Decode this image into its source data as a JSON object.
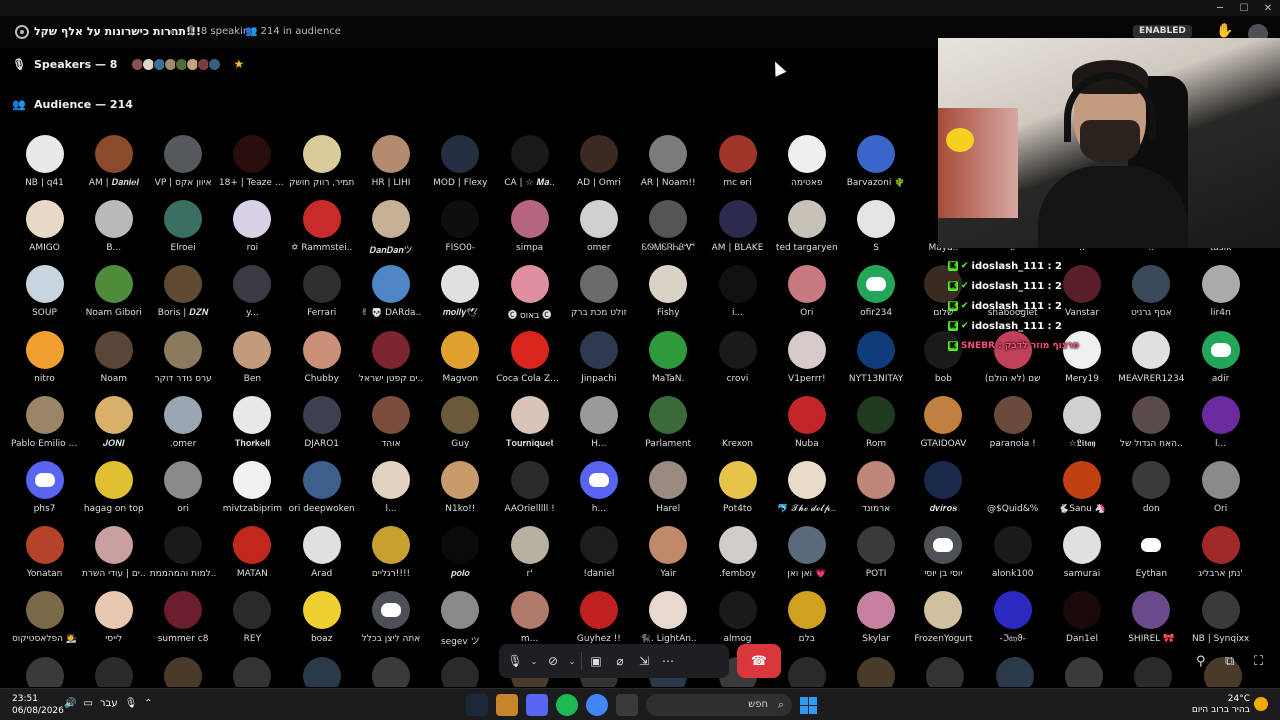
{
  "window": {
    "controls": [
      "─",
      "☐",
      "✕"
    ]
  },
  "topbar": {
    "title": "תחרות כישרונות על אלף שקל!!!",
    "speaking": "8 speaking",
    "audience_count": "214 in audience",
    "enabled_label": "ENABLED",
    "hand_icon": "✋"
  },
  "speakers": {
    "label": "Speakers — 8",
    "avatar_colors": [
      "#8a4f4f",
      "#ded8cc",
      "#3d6e9a",
      "#a58a6a",
      "#546a3c",
      "#c8a27c",
      "#7b3e3e",
      "#3b5f7a"
    ]
  },
  "audience": {
    "label": "Audience — 214",
    "rows": [
      [
        {
          "n": "NB | q41",
          "c": "#e9e9e9"
        },
        {
          "n": "AM | 𝑫𝒂𝒏𝒊𝒆𝒍",
          "c": "#8a4b2c"
        },
        {
          "n": "VP | איוון אקס",
          "c": "#55585c"
        },
        {
          "n": "18+ | Teaze (יי..",
          "c": "#2a0d0d"
        },
        {
          "n": "תמיר, רווק חושק",
          "c": "#d9cc9a"
        },
        {
          "n": "HR | LIHI",
          "c": "#b58b6f"
        },
        {
          "n": "MOD | Flexy",
          "c": "#243041"
        },
        {
          "n": "CA | ☆ 𝑴𝒂..",
          "c": "#191919"
        },
        {
          "n": "AD | Omri",
          "c": "#3a2a22"
        },
        {
          "n": "AR | Noam!!",
          "c": "#7c7c7c"
        },
        {
          "n": "mc ɵri",
          "c": "#a0352a"
        },
        {
          "n": "פאטימה",
          "c": "#efefef"
        },
        {
          "n": "Barvazoni 🌵",
          "c": "#3b66c9"
        },
        {
          "n": "",
          "c": "#3e6fb0"
        }
      ],
      [
        {
          "n": "AMIGO",
          "c": "#e7d9c6"
        },
        {
          "n": "B...",
          "c": "#b9b9b9"
        },
        {
          "n": "Elroei",
          "c": "#3b6f62"
        },
        {
          "n": "roi",
          "c": "#d9d2e6"
        },
        {
          "n": "✡ Rammstei..",
          "c": "#c92a2a"
        },
        {
          "n": "𝑫𝒂𝒏𝑫𝒂𝒏ツ",
          "c": "#c7b195"
        },
        {
          "n": "FISO0-",
          "c": "#0e0e0e"
        },
        {
          "n": "simpa",
          "c": "#b5657e"
        },
        {
          "n": "omer",
          "c": "#d0d0d0"
        },
        {
          "n": "ᏋᏫᎷᏋᏒᏂᏰᏉ",
          "c": "#555"
        },
        {
          "n": "AM | BLAKE",
          "c": "#2d2a4f"
        },
        {
          "n": "ted targaryen",
          "c": "#c8c1b8"
        },
        {
          "n": "S",
          "c": "#e5e5e5"
        },
        {
          "n": "",
          "c": "#000"
        }
      ],
      [
        {
          "n": "SOUP",
          "c": "#c8d4e0"
        },
        {
          "n": "Noam Gibori",
          "c": "#4e8c3a"
        },
        {
          "n": "Boris | 𝑫𝒁𝑵",
          "c": "#5f4a34"
        },
        {
          "n": "y...",
          "c": "#3a3a44"
        },
        {
          "n": "Ferrari",
          "c": "#2f2f2f"
        },
        {
          "n": "✌ 💀 DARda..",
          "c": "#4f86c6"
        },
        {
          "n": "𝒎𝒐𝒍𝒍𝒚🕊",
          "c": "#e0e0e0"
        },
        {
          "n": "🅒 באוס 🅒",
          "c": "#e08fa0"
        },
        {
          "n": "זולט מכת ברק",
          "c": "#6b6b6b"
        },
        {
          "n": "Fishy",
          "c": "#d9d2c6"
        },
        {
          "n": "i...",
          "c": "#111"
        },
        {
          "n": "Ori",
          "c": "#c77a80"
        },
        {
          "n": "ofir234",
          "c": "#23a55a",
          "d": true
        },
        {
          "n": "",
          "c": "#000"
        }
      ],
      [
        {
          "n": "nitro",
          "c": "#f0a030"
        },
        {
          "n": "Noam",
          "c": "#5a4638"
        },
        {
          "n": "ערס נודר דוקר",
          "c": "#8c7a5e"
        },
        {
          "n": "Ben",
          "c": "#c39a7a"
        },
        {
          "n": "Chubby",
          "c": "#c98f79"
        },
        {
          "n": "ים קפטן ישראל..",
          "c": "#7b2530"
        },
        {
          "n": "Magvon",
          "c": "#e0a030"
        },
        {
          "n": "Coca Cola Zero",
          "c": "#d9251c"
        },
        {
          "n": "Jinpachi",
          "c": "#2e3a52"
        },
        {
          "n": "MaTaN.",
          "c": "#2f9a3c"
        },
        {
          "n": "crovi",
          "c": "#1a1a1a"
        },
        {
          "n": "V1perrr!",
          "c": "#d6cbc9"
        },
        {
          "n": "NYT13NITAY",
          "c": "#0f3c7a"
        },
        {
          "n": "",
          "c": "#000"
        }
      ],
      [
        {
          "n": "Pablo Emilio E..",
          "c": "#9a8566"
        },
        {
          "n": "𝑱𝑶𝑵𝑰",
          "c": "#d8b06a"
        },
        {
          "n": ".omer",
          "c": "#9aa6b0"
        },
        {
          "n": "𝐓𝐡𝐨𝐫𝐤𝐞𝐥𝐥",
          "c": "#e8e8e8"
        },
        {
          "n": "DJARO1",
          "c": "#3c4050"
        },
        {
          "n": "אוהד",
          "c": "#7a4c3c"
        },
        {
          "n": "Guy",
          "c": "#6b5a3a"
        },
        {
          "n": "𝐓𝐨𝐮𝐫𝐧𝐢𝐪𝐮𝐞𝐭",
          "c": "#d8c4b8"
        },
        {
          "n": "H...",
          "c": "#9a9a9a"
        },
        {
          "n": "Parlament",
          "c": "#3a6a3a"
        },
        {
          "n": "Krexon",
          "c": "#000"
        },
        {
          "n": "Nuba",
          "c": "#c2262a"
        },
        {
          "n": "Rom",
          "c": "#1f3a1f"
        },
        {
          "n": "",
          "c": "#000"
        }
      ],
      [
        {
          "n": "phs7",
          "c": "#5865f2",
          "d": true
        },
        {
          "n": "hagag on top",
          "c": "#e0c030"
        },
        {
          "n": "ori",
          "c": "#8a8a8a"
        },
        {
          "n": "mivtzabiprim",
          "c": "#f0f0f0"
        },
        {
          "n": "ori deepwoken",
          "c": "#3e5f8a"
        },
        {
          "n": "l...",
          "c": "#e2d2c0"
        },
        {
          "n": "N1ko!!",
          "c": "#c99a6a"
        },
        {
          "n": "AAOrielllll !",
          "c": "#2a2a2a"
        },
        {
          "n": "h...",
          "c": "#5865f2",
          "d": true
        },
        {
          "n": "Harel",
          "c": "#9a8a80"
        },
        {
          "n": "Pot4to",
          "c": "#e6c34a"
        },
        {
          "n": "🐬 𝓣𝓱𝓮 𝓭𝓸𝓵𝓹..",
          "c": "#e8dcc8"
        },
        {
          "n": "ארמונד",
          "c": "#c0857a"
        },
        {
          "n": "",
          "c": "#000"
        }
      ],
      [
        {
          "n": "Yonatan",
          "c": "#b5432a"
        },
        {
          "n": "ים | עודי השרת..",
          "c": "#c8a0a0"
        },
        {
          "n": "למות והמהממת..",
          "c": "#1a1a1a"
        },
        {
          "n": "MATAN",
          "c": "#c0291c"
        },
        {
          "n": "Arad",
          "c": "#e0e0e0"
        },
        {
          "n": "רגליים!!!!",
          "c": "#c8a030"
        },
        {
          "n": "𝒑𝒐𝒍𝒐",
          "c": "#0a0a0a"
        },
        {
          "n": "r'",
          "c": "#b8b0a0"
        },
        {
          "n": "!daniel",
          "c": "#1e1e1e"
        },
        {
          "n": "Yair",
          "c": "#c08a6a"
        },
        {
          "n": ".femboy",
          "c": "#d0cdc8"
        },
        {
          "n": "ואן ואן 💗",
          "c": "#5a6a7a"
        },
        {
          "n": "POTI",
          "c": "#3a3a3a"
        },
        {
          "n": "",
          "c": "#000"
        }
      ],
      [
        {
          "n": "הפלאסטיקוס 🧑‍🎨",
          "c": "#7a6a4a"
        },
        {
          "n": "לייסי",
          "c": "#e8c8b0"
        },
        {
          "n": "summer c8",
          "c": "#6a1e2e"
        },
        {
          "n": "REY",
          "c": "#2a2a2a"
        },
        {
          "n": "boaz",
          "c": "#f0d030"
        },
        {
          "n": "אתה ליצן בכלל",
          "c": "#4e5058",
          "d": true
        },
        {
          "n": "segev ツ",
          "c": "#8a8a8a"
        },
        {
          "n": "m...",
          "c": "#b07a6a"
        },
        {
          "n": "Guyhez !!",
          "c": "#c02020"
        },
        {
          "n": "🐈‍⬛. LightAn..",
          "c": "#e8d8d0"
        },
        {
          "n": "almog",
          "c": "#1a1a1a"
        },
        {
          "n": "בלם",
          "c": "#d0a020"
        },
        {
          "n": "Skylar",
          "c": "#c880a0"
        },
        {
          "n": "",
          "c": "#000"
        }
      ]
    ]
  },
  "audience_right": {
    "rows": [
      [
        {
          "n": "Maya..",
          "c": "#000"
        },
        {
          "n": "..",
          "c": "#000"
        },
        {
          "n": "..",
          "c": "#000"
        },
        {
          "n": "..",
          "c": "#000"
        },
        {
          "n": "tasik",
          "c": "#000"
        }
      ],
      [
        {
          "n": "שלום",
          "c": "#3a2a22"
        },
        {
          "n": "shabooglet",
          "c": "#000"
        },
        {
          "n": "Vanstar",
          "c": "#5a1e2a"
        },
        {
          "n": "אסף גרניט",
          "c": "#3a4a5a"
        },
        {
          "n": "lir4n",
          "c": "#aaa"
        }
      ],
      [
        {
          "n": "bob",
          "c": "#1a1a1a"
        },
        {
          "n": "שם (לא הולם)",
          "c": "#c0405a"
        },
        {
          "n": "Mery19",
          "c": "#f0f0f0"
        },
        {
          "n": "MEAVRER1234",
          "c": "#e0e0e0"
        },
        {
          "n": "adir",
          "c": "#23a55a",
          "d": true
        }
      ],
      [
        {
          "n": "GTAIDOAV",
          "c": "#c08040"
        },
        {
          "n": "paranoia !",
          "c": "#6a4a3a"
        },
        {
          "n": "☆𝕷𝖎𝖙𝖆𝖞",
          "c": "#d0d0d0"
        },
        {
          "n": "האח הגדול של..",
          "c": "#5a4a4a"
        },
        {
          "n": "l...",
          "c": "#6a2aa0"
        }
      ],
      [
        {
          "n": "𝒅𝒗𝒊𝒓𝒐𝒔",
          "c": "#1a2a4a"
        },
        {
          "n": "@$Quid&%",
          "c": "#000"
        },
        {
          "n": "🐇Sanu 🦄",
          "c": "#c04010"
        },
        {
          "n": "don",
          "c": "#3a3a3a"
        },
        {
          "n": "Ori",
          "c": "#8a8a8a"
        }
      ],
      [
        {
          "n": "יוסי בן יוסי",
          "c": "#4e5058",
          "d": true
        },
        {
          "n": "alonk100",
          "c": "#1a1a1a"
        },
        {
          "n": "samurai",
          "c": "#e0e0e0"
        },
        {
          "n": "Eythan",
          "c": "#000",
          "d": true
        },
        {
          "n": "נתן ארבליג'",
          "c": "#a02a2a"
        }
      ],
      [
        {
          "n": "FrozenYogurt",
          "c": "#d0c0a0"
        },
        {
          "n": "-ℑ𝔞𝔶ϑ-",
          "c": "#2a2ac0"
        },
        {
          "n": "Dan1el",
          "c": "#1a0a0a"
        },
        {
          "n": "SHIREL 🎀",
          "c": "#6a4a8a"
        },
        {
          "n": "NB | Synqixx",
          "c": "#3a3a3a"
        }
      ]
    ]
  },
  "overlay_chat": {
    "lines": [
      "idoslash_111 : 2",
      "idoslash_111 : 2",
      "idoslash_111 : 2",
      "idoslash_111 : 2"
    ],
    "last_line": "SNEBR : פרצוף מוזר לדבק"
  },
  "callbar": {
    "leave_icon": "☎"
  },
  "taskbar": {
    "time": "23:51",
    "date": "06/08/2026",
    "lang": "עבר",
    "search_text": "חפש",
    "temp": "24°C",
    "weather": "בהיר ברוב היום"
  }
}
